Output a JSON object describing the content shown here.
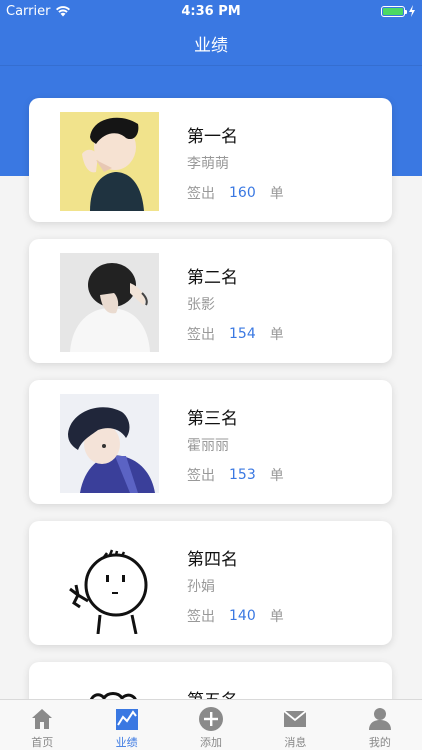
{
  "status_bar": {
    "carrier": "Carrier",
    "time": "4:36 PM"
  },
  "nav": {
    "title": "业绩"
  },
  "accent_color": "#3a78e2",
  "ranking": [
    {
      "rank": "第一名",
      "name": "李萌萌",
      "label": "签出",
      "count": "160",
      "unit": "单"
    },
    {
      "rank": "第二名",
      "name": "张影",
      "label": "签出",
      "count": "154",
      "unit": "单"
    },
    {
      "rank": "第三名",
      "name": "霍丽丽",
      "label": "签出",
      "count": "153",
      "unit": "单"
    },
    {
      "rank": "第四名",
      "name": "孙娟",
      "label": "签出",
      "count": "140",
      "unit": "单"
    },
    {
      "rank": "第五名",
      "name": "",
      "label": "",
      "count": "",
      "unit": ""
    }
  ],
  "tabbar": {
    "items": [
      {
        "label": "首页",
        "icon": "home-icon"
      },
      {
        "label": "业绩",
        "icon": "chart-icon"
      },
      {
        "label": "添加",
        "icon": "add-icon"
      },
      {
        "label": "消息",
        "icon": "mail-icon"
      },
      {
        "label": "我的",
        "icon": "user-icon"
      }
    ],
    "active": "业绩"
  }
}
